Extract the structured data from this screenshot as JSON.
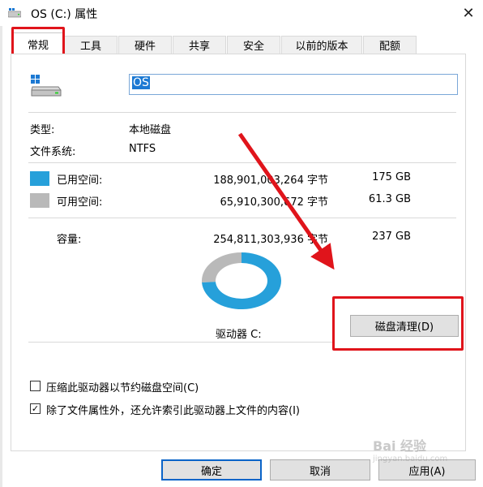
{
  "window": {
    "title": "OS (C:) 属性",
    "close_glyph": "✕"
  },
  "tabs": [
    {
      "label": "常规",
      "active": true
    },
    {
      "label": "工具",
      "active": false
    },
    {
      "label": "硬件",
      "active": false
    },
    {
      "label": "共享",
      "active": false
    },
    {
      "label": "安全",
      "active": false
    },
    {
      "label": "以前的版本",
      "active": false
    },
    {
      "label": "配额",
      "active": false
    }
  ],
  "general": {
    "drive_name_value": "OS",
    "type_label": "类型:",
    "type_value": "本地磁盘",
    "fs_label": "文件系统:",
    "fs_value": "NTFS",
    "used_label": "已用空间:",
    "used_bytes": "188,901,003,264 字节",
    "used_size": "175 GB",
    "free_label": "可用空间:",
    "free_bytes": "65,910,300,672 字节",
    "free_size": "61.3 GB",
    "capacity_label": "容量:",
    "capacity_bytes": "254,811,303,936 字节",
    "capacity_size": "237 GB",
    "drive_label": "驱动器 C:",
    "used_fraction": 0.741,
    "cleanup_button": "磁盘清理(D)",
    "compress_label": "压缩此驱动器以节约磁盘空间(C)",
    "compress_checked": false,
    "index_label": "除了文件属性外，还允许索引此驱动器上文件的内容(I)",
    "index_checked": true,
    "check_glyph": "✓"
  },
  "buttons": {
    "ok": "确定",
    "cancel": "取消",
    "apply": "应用(A)"
  },
  "watermark": {
    "logo": "Bai 经验",
    "url": "jingyan.baidu.com"
  },
  "colors": {
    "used": "#26a0da",
    "free": "#b9b9b9",
    "annotation": "#e0141b",
    "selection": "#1c79d3"
  }
}
